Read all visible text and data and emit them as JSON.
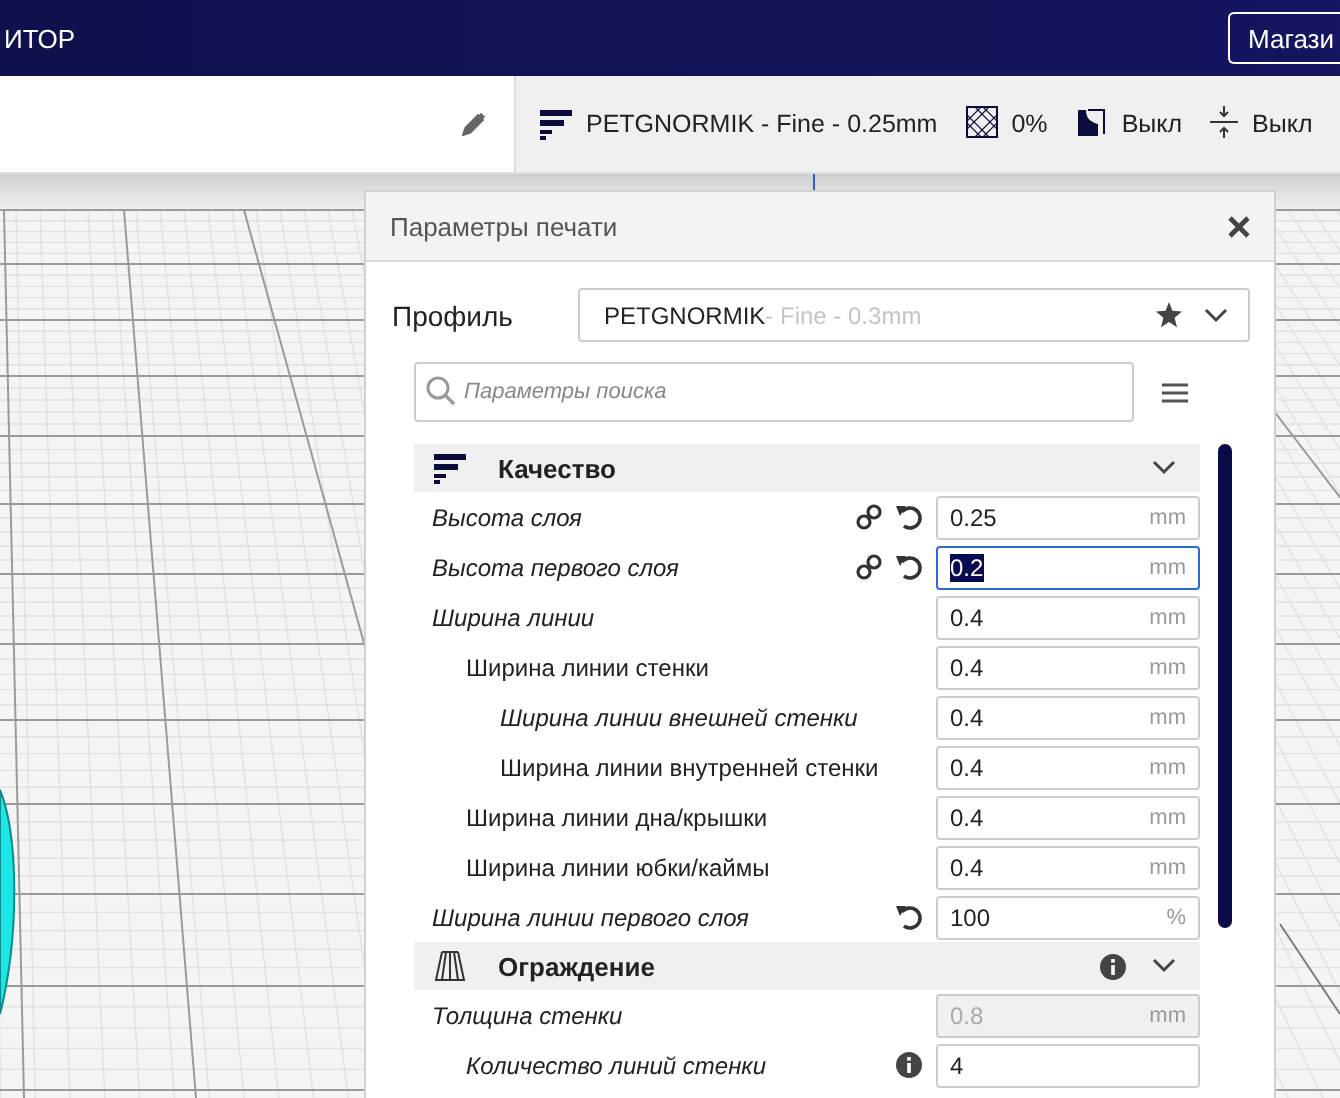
{
  "header": {
    "title": "ИТОР",
    "marketplace_button": "Магази"
  },
  "toolbar": {
    "profile": "PETGNORMIK - Fine - 0.25mm",
    "infill": "0%",
    "support": "Выкл",
    "adhesion": "Выкл"
  },
  "panel": {
    "title": "Параметры печати",
    "profile_label": "Профиль",
    "profile_name": "PETGNORMIK",
    "profile_quality": " - Fine - 0.3mm",
    "search": {
      "placeholder": "Параметры поиска"
    },
    "sections": [
      {
        "title": "Качество",
        "info": false,
        "expanded": true,
        "settings": [
          {
            "label": "Высота слоя",
            "italic": true,
            "linked": true,
            "resettable": true,
            "info": false,
            "value": "0.25",
            "unit": "mm",
            "focused": false,
            "disabled": false
          },
          {
            "label": "Высота первого слоя",
            "italic": true,
            "linked": true,
            "resettable": true,
            "info": false,
            "value": "0.2",
            "unit": "mm",
            "focused": true,
            "disabled": false
          },
          {
            "label": "Ширина линии",
            "italic": true,
            "linked": false,
            "resettable": false,
            "info": false,
            "value": "0.4",
            "unit": "mm",
            "focused": false,
            "disabled": false,
            "children": [
              {
                "label": "Ширина линии стенки",
                "italic": false,
                "linked": false,
                "resettable": false,
                "info": false,
                "value": "0.4",
                "unit": "mm",
                "focused": false,
                "disabled": false,
                "children": [
                  {
                    "label": "Ширина линии внешней стенки",
                    "italic": true,
                    "linked": false,
                    "resettable": false,
                    "info": false,
                    "value": "0.4",
                    "unit": "mm",
                    "focused": false,
                    "disabled": false
                  },
                  {
                    "label": "Ширина линии внутренней стенки",
                    "italic": false,
                    "linked": false,
                    "resettable": false,
                    "info": false,
                    "value": "0.4",
                    "unit": "mm",
                    "focused": false,
                    "disabled": false
                  }
                ]
              },
              {
                "label": "Ширина линии дна/крышки",
                "italic": false,
                "linked": false,
                "resettable": false,
                "info": false,
                "value": "0.4",
                "unit": "mm",
                "focused": false,
                "disabled": false
              },
              {
                "label": "Ширина линии юбки/каймы",
                "italic": false,
                "linked": false,
                "resettable": false,
                "info": false,
                "value": "0.4",
                "unit": "mm",
                "focused": false,
                "disabled": false
              }
            ]
          },
          {
            "label": "Ширина линии первого слоя",
            "italic": true,
            "linked": false,
            "resettable": true,
            "info": false,
            "value": "100",
            "unit": "%",
            "focused": false,
            "disabled": false
          }
        ]
      },
      {
        "title": "Ограждение",
        "info": true,
        "expanded": true,
        "settings": [
          {
            "label": "Толщина стенки",
            "italic": true,
            "linked": false,
            "resettable": false,
            "info": false,
            "value": "0.8",
            "unit": "mm",
            "focused": false,
            "disabled": true,
            "children": [
              {
                "label": "Количество линий стенки",
                "italic": true,
                "linked": false,
                "resettable": false,
                "info": true,
                "value": "4",
                "focused": false,
                "disabled": false
              }
            ]
          }
        ]
      }
    ]
  }
}
